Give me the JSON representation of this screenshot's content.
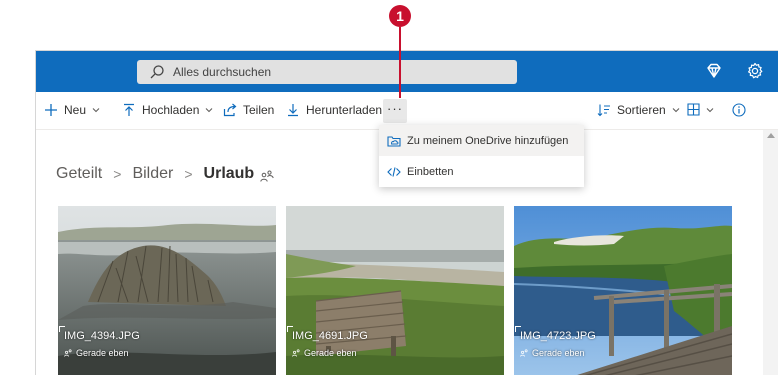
{
  "callout": {
    "number": "1"
  },
  "search": {
    "placeholder": "Alles durchsuchen"
  },
  "toolbar": {
    "new_label": "Neu",
    "upload_label": "Hochladen",
    "share_label": "Teilen",
    "download_label": "Herunterladen",
    "more_label": "···",
    "sort_label": "Sortieren"
  },
  "menu": {
    "items": [
      {
        "label": "Zu meinem OneDrive hinzufügen",
        "icon": "add-to-onedrive-icon"
      },
      {
        "label": "Einbetten",
        "icon": "embed-code-icon"
      }
    ]
  },
  "breadcrumb": {
    "items": [
      "Geteilt",
      "Bilder",
      "Urlaub"
    ],
    "separator": ">"
  },
  "photos": [
    {
      "name": "IMG_4394.JPG",
      "modified": "Gerade eben"
    },
    {
      "name": "IMG_4691.JPG",
      "modified": "Gerade eben"
    },
    {
      "name": "IMG_4723.JPG",
      "modified": "Gerade eben"
    }
  ],
  "colors": {
    "brand": "#0f6cbd",
    "accent_icon": "#0f6cbd",
    "callout": "#c8102e"
  }
}
